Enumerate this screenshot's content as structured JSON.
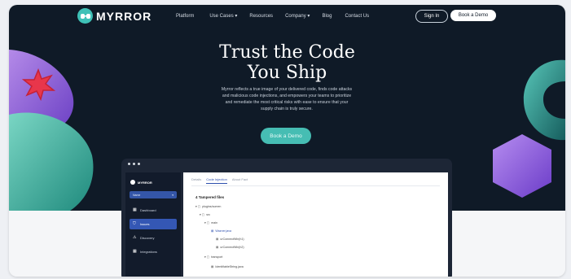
{
  "brand": {
    "name": "MYRROR",
    "logo_icon": "eyes-logo-icon"
  },
  "nav": {
    "items": [
      {
        "label": "Platform"
      },
      {
        "label": "Use Cases",
        "caret": "▾"
      },
      {
        "label": "Resources"
      },
      {
        "label": "Company",
        "caret": "▾"
      },
      {
        "label": "Blog"
      },
      {
        "label": "Contact Us"
      }
    ],
    "signin_label": "Sign In",
    "book_label": "Book a Demo"
  },
  "hero": {
    "headline_line1": "Trust the Code",
    "headline_line2": "You Ship",
    "subtext_lines": [
      "Myrror reflects a true image of your delivered code, finds code attacks",
      "and malicious code injections, and empowers your teams to prioritize",
      "and remediate the most critical risks with ease to ensure that your",
      "supply chain is truly secure."
    ],
    "cta_label": "Book a Demo"
  },
  "app": {
    "logo_label": "MYRROR",
    "selector_value": "Name",
    "sidebar": [
      {
        "label": "Dashboard",
        "icon": "grid-icon",
        "active": false
      },
      {
        "label": "Issues",
        "icon": "shield-icon",
        "active": true
      },
      {
        "label": "Discovery",
        "icon": "warning-icon",
        "active": false
      },
      {
        "label": "Integrations",
        "icon": "grid-icon",
        "active": false
      }
    ],
    "tabs": [
      {
        "label": "Details",
        "active": false
      },
      {
        "label": "Code Injection",
        "active": true
      },
      {
        "label": "About Fact",
        "active": false
      }
    ],
    "files_title": "4 Tampered files",
    "tree": [
      {
        "label": "plugins/cumen",
        "prefix": "▾ ▢"
      },
      {
        "label": "src",
        "prefix": "▾ ▢"
      },
      {
        "label": "main",
        "prefix": "▾ ▢"
      },
      {
        "label": "Wazner.java",
        "prefix": "▤",
        "link": true
      },
      {
        "label": "urConnectWin(h1)",
        "prefix": "▤"
      },
      {
        "label": "urConnectWin(h2)",
        "prefix": "▤"
      },
      {
        "label": "transport",
        "prefix": "▾ ▢"
      },
      {
        "label": "IdentifiableString.java",
        "prefix": "▤"
      }
    ]
  },
  "colors": {
    "hero_bg": "#0f1a27",
    "accent_teal": "#46bdb3",
    "active_blue": "#3457b4",
    "shape_purple": "#8a5bd8",
    "shape_red": "#e8364b"
  }
}
